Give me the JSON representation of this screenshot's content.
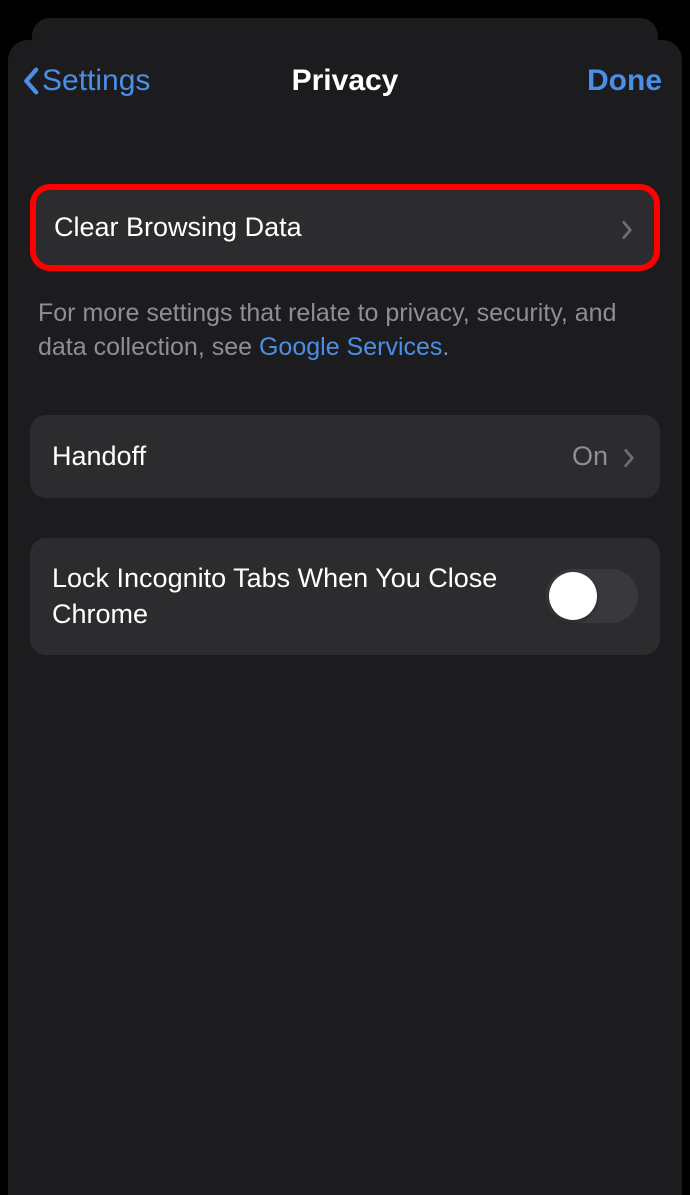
{
  "nav": {
    "back_label": "Settings",
    "title": "Privacy",
    "done_label": "Done"
  },
  "rows": {
    "clear_browsing": {
      "label": "Clear Browsing Data"
    },
    "handoff": {
      "label": "Handoff",
      "value": "On"
    },
    "lock_incognito": {
      "label": "Lock Incognito Tabs When You Close Chrome",
      "state": "off"
    }
  },
  "footer": {
    "text_prefix": "For more settings that relate to privacy, security, and data collection, see ",
    "link_text": "Google Services",
    "text_suffix": "."
  }
}
